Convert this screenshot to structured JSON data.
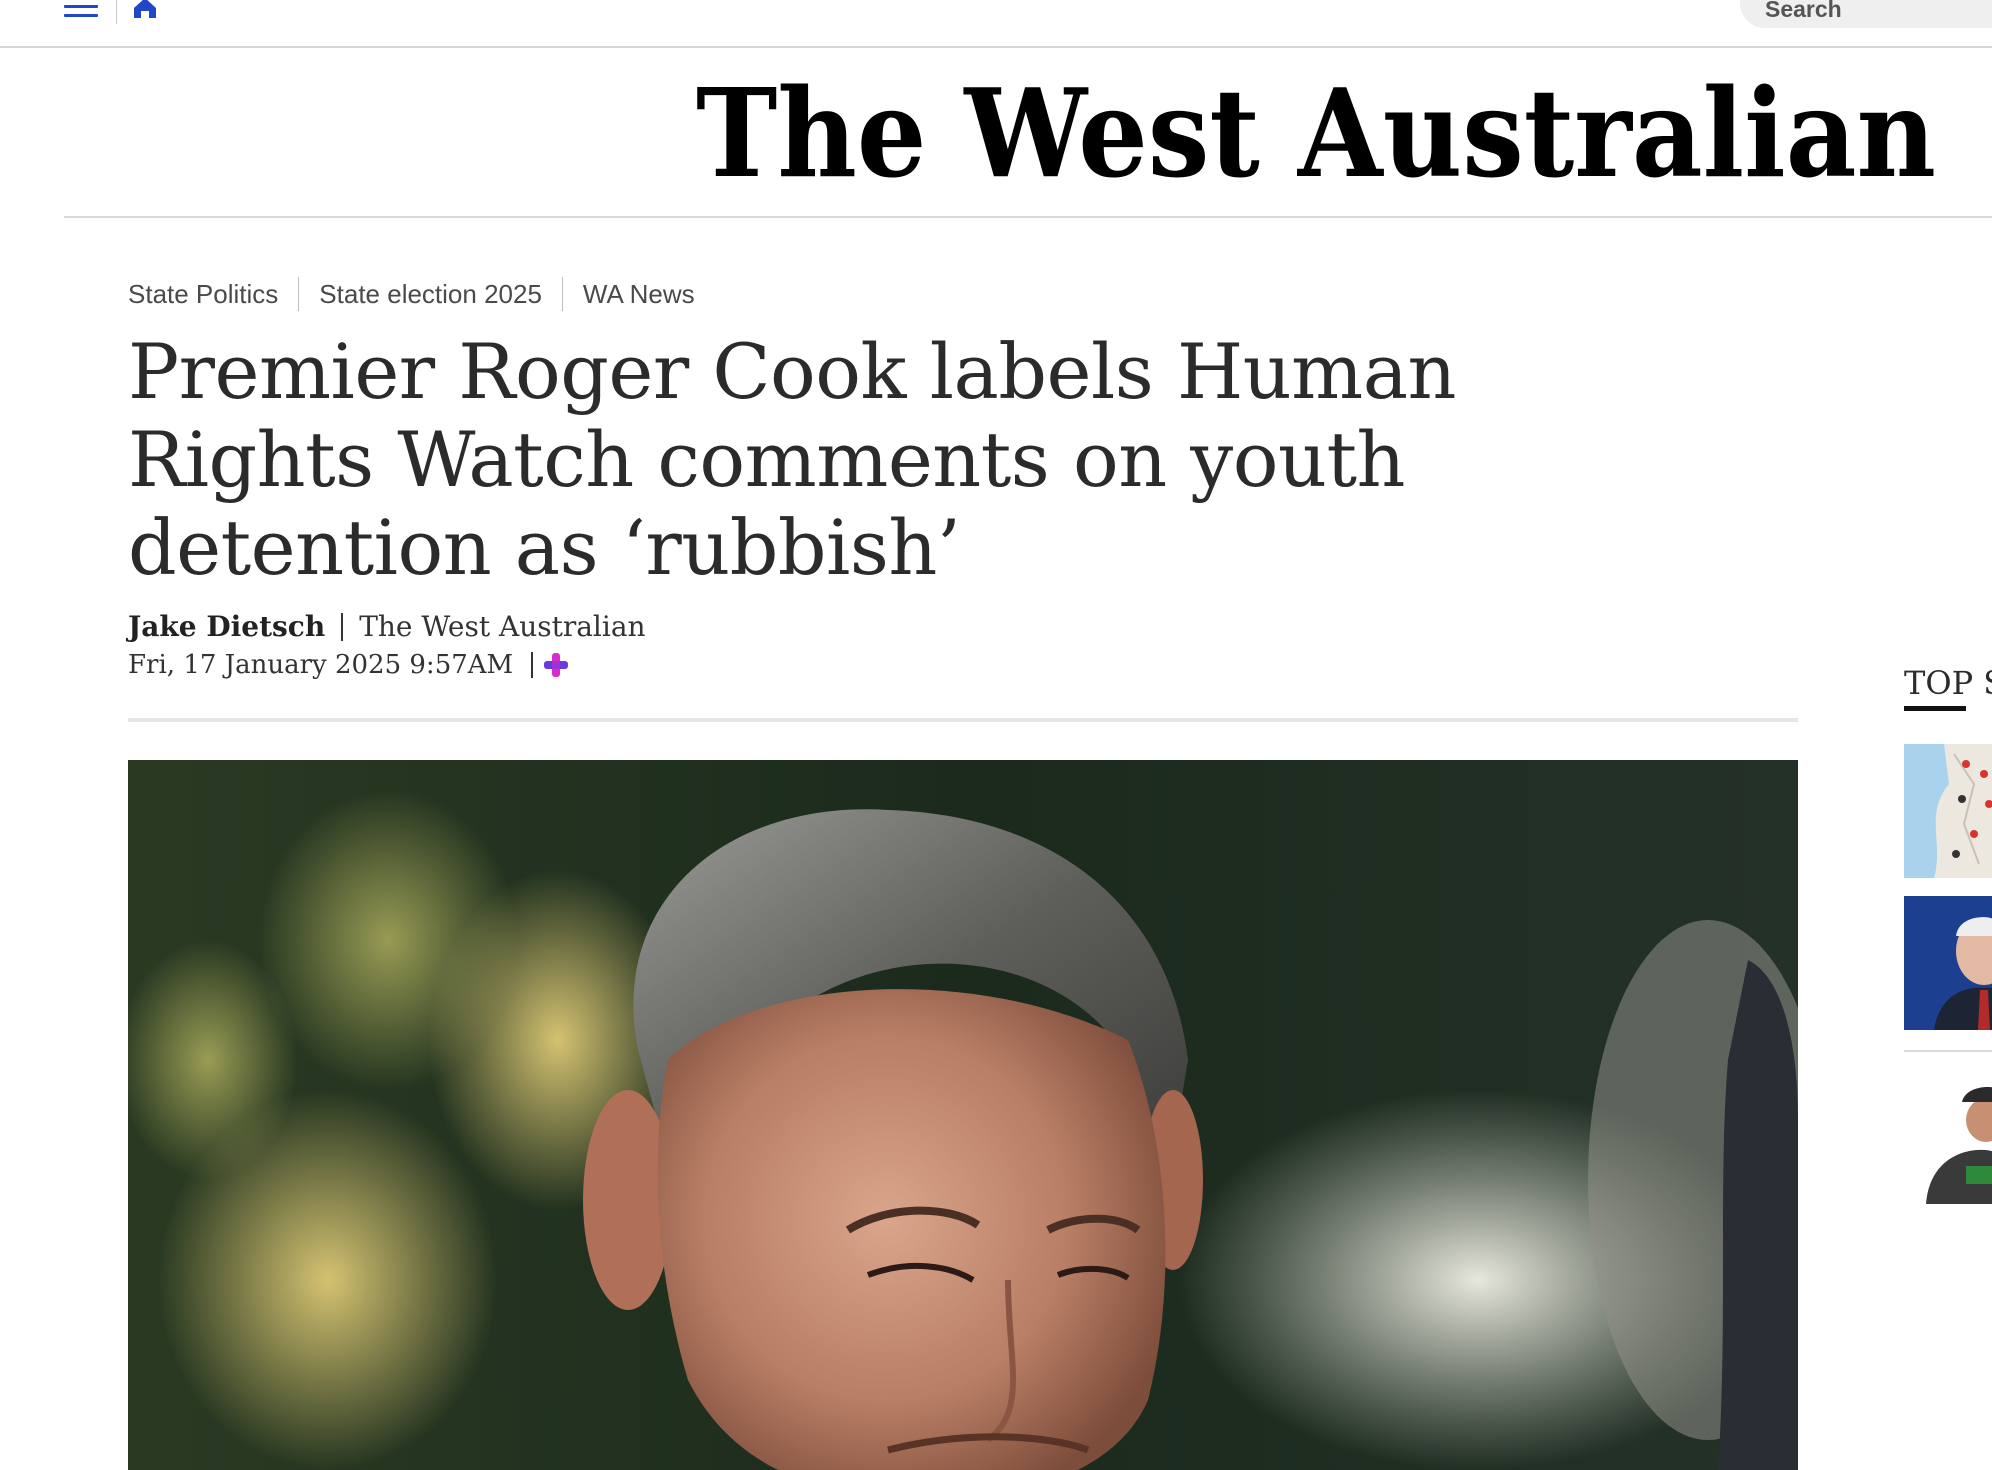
{
  "topbar": {
    "search_label": "Search"
  },
  "masthead": {
    "logo_text": "The West Australian"
  },
  "breadcrumb": [
    "State Politics",
    "State election 2025",
    "WA News"
  ],
  "article": {
    "headline": "Premier Roger Cook labels Human Rights Watch comments on youth detention as ‘rubbish’",
    "author": "Jake Dietsch",
    "publication": "The West Australian",
    "published": "Fri, 17 January 2025 9:57AM"
  },
  "sidebar": {
    "heading": "TOP S"
  },
  "icons": {
    "menu": "hamburger-icon",
    "home": "home-icon",
    "premium": "plus-icon"
  },
  "colors": {
    "accent_blue": "#1f47c7",
    "premium_magenta": "#d92bd1",
    "premium_purple": "#6a3bd8"
  }
}
